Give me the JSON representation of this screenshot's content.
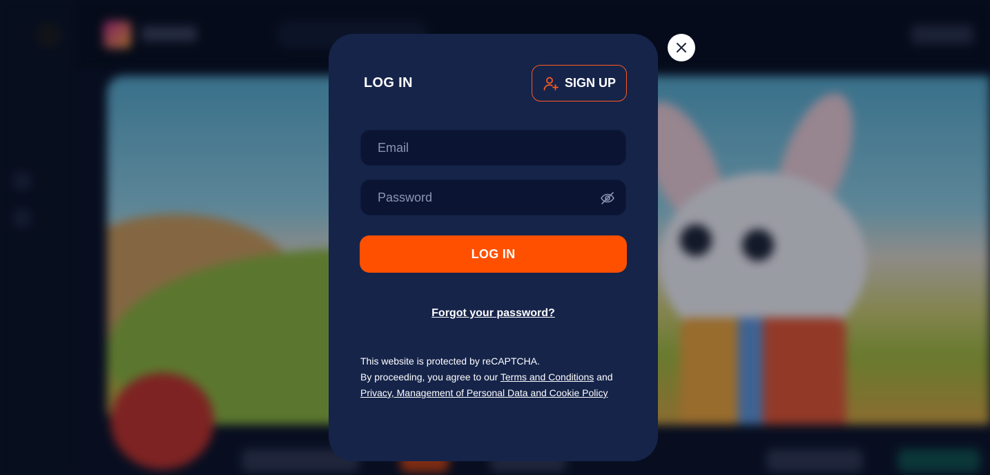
{
  "modal": {
    "title": "LOG IN",
    "signup_label": "SIGN UP",
    "email_placeholder": "Email",
    "password_placeholder": "Password",
    "login_button": "LOG IN",
    "forgot_password": "Forgot your password?",
    "legal": {
      "line1": "This website is protected by reCAPTCHA.",
      "line2_prefix": "By proceeding, you agree to our ",
      "terms_link": "Terms and Conditions",
      "line2_suffix": " and",
      "privacy_link": "Privacy, Management of Personal Data and Cookie Policy"
    }
  },
  "icons": {
    "signup": "user-plus-icon",
    "password_toggle": "eye-off-icon",
    "close": "close-icon"
  },
  "colors": {
    "accent": "#ff5000",
    "modal_bg": "#16244a",
    "field_bg": "#0b1533"
  }
}
